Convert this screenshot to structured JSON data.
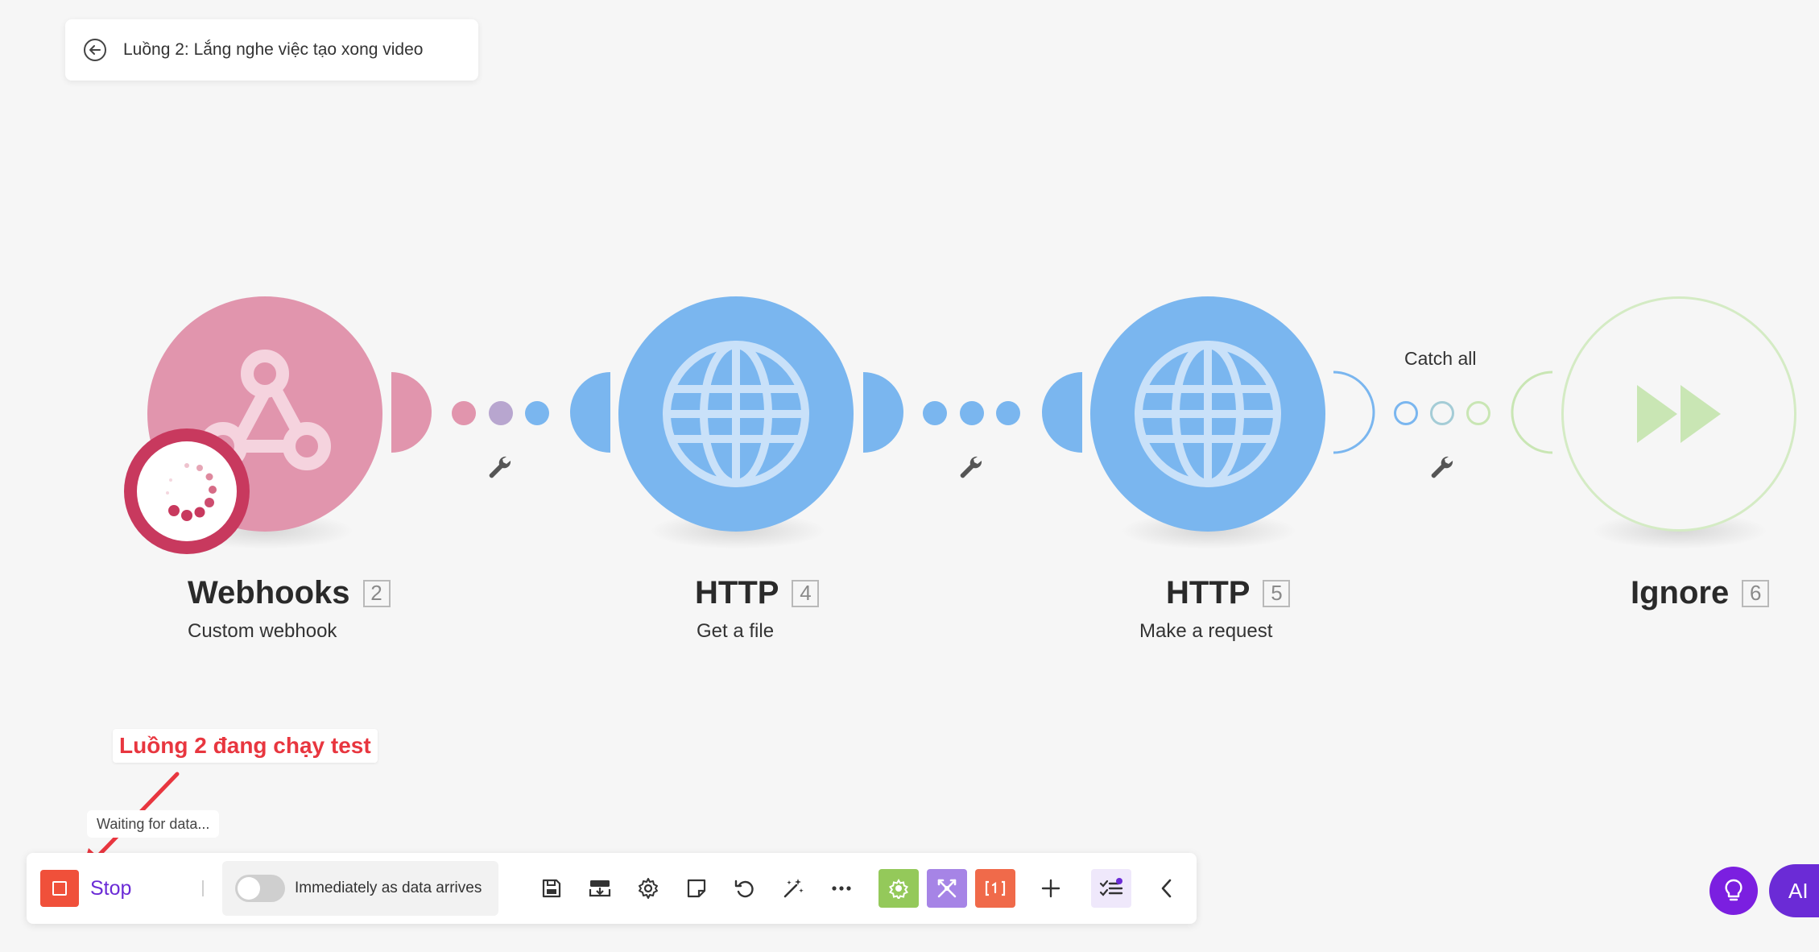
{
  "scenario": {
    "title": "Luồng 2: Lắng nghe việc tạo xong video"
  },
  "modules": [
    {
      "name": "Webhooks",
      "id": "2",
      "subtitle": "Custom webhook",
      "icon": "webhook-icon",
      "color": "#e195ad"
    },
    {
      "name": "HTTP",
      "id": "4",
      "subtitle": "Get a file",
      "icon": "globe-icon",
      "color": "#7ab6ef"
    },
    {
      "name": "HTTP",
      "id": "5",
      "subtitle": "Make a request",
      "icon": "globe-icon",
      "color": "#7ab6ef"
    },
    {
      "name": "Ignore",
      "id": "6",
      "subtitle": "",
      "icon": "fast-forward-icon",
      "color": "#c9e6b4"
    }
  ],
  "routes": {
    "catch_label": "Catch all"
  },
  "annotation": {
    "text": "Luồng 2 đang chạy test"
  },
  "status": {
    "tooltip": "Waiting for data..."
  },
  "toolbar": {
    "stop_label": "Stop",
    "schedule_label": "Immediately as data arrives",
    "icons": [
      "save-icon",
      "import-export-icon",
      "settings-icon",
      "notes-icon",
      "undo-icon",
      "magic-wand-icon",
      "more-icon",
      "tools-icon",
      "flow-control-icon",
      "text-parser-icon",
      "add-icon",
      "checklist-icon",
      "collapse-icon"
    ]
  },
  "fab": {
    "ai_label": "AI"
  }
}
